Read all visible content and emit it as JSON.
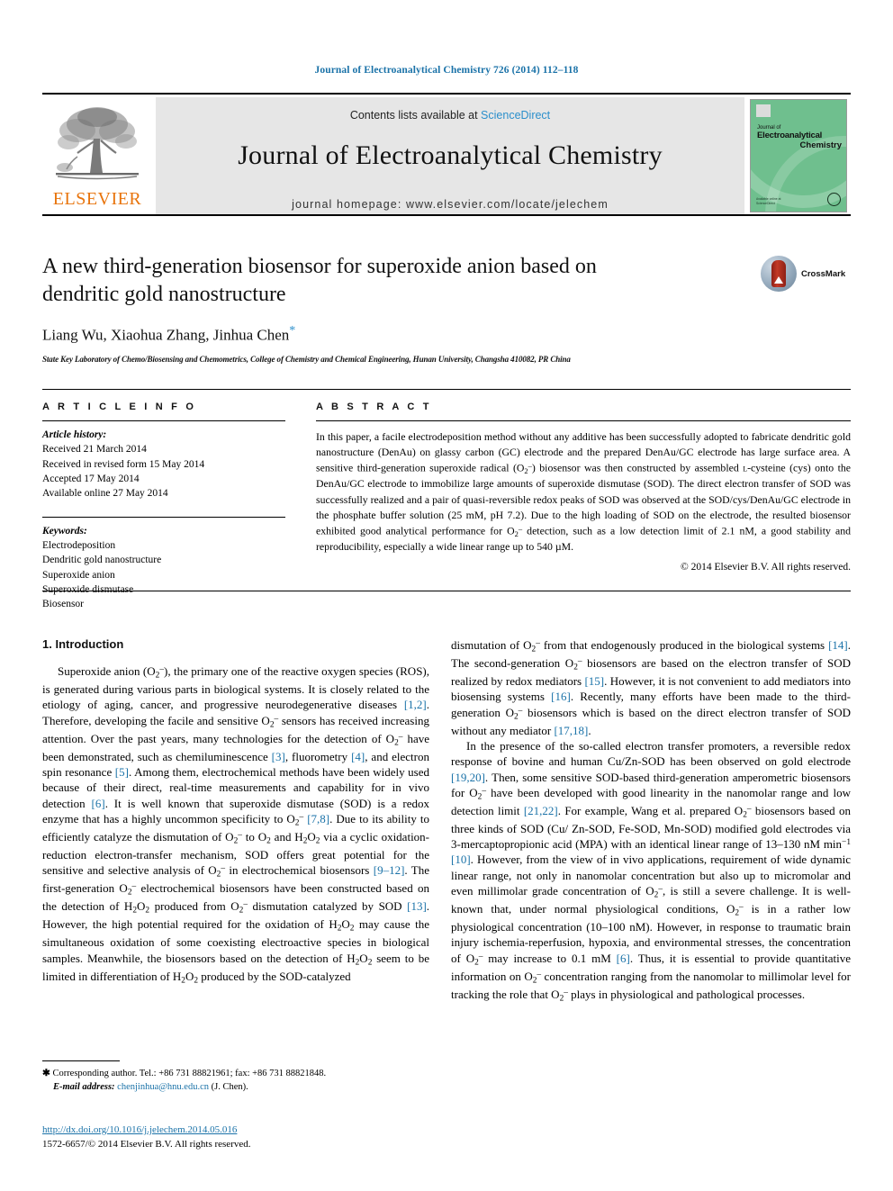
{
  "running_head": "Journal of Electroanalytical Chemistry 726 (2014) 112–118",
  "masthead": {
    "contents_prefix": "Contents lists available at ",
    "sciencedirect": "ScienceDirect",
    "journal_title": "Journal of Electroanalytical Chemistry",
    "homepage": "journal homepage: www.elsevier.com/locate/jelechem",
    "publisher_wordmark": "ELSEVIER",
    "cover": {
      "line1": "Journal of",
      "line2": "Electroanalytical",
      "line3": "Chemistry",
      "footer_left": "Available online at\nScienceDirect",
      "footer_right": "Official journal of the\nInternational Society of\nElectrochemistry"
    },
    "colors": {
      "link": "#2b8fcb",
      "elsevier_orange": "#e8740c",
      "cover_green": "#6fbf8e",
      "band_gray": "#e6e6e6"
    }
  },
  "article": {
    "title": "A new third-generation biosensor for superoxide anion based on dendritic gold nanostructure",
    "authors": "Liang Wu, Xiaohua Zhang, Jinhua Chen",
    "corresponding_marker": "*",
    "affiliation": "State Key Laboratory of Chemo/Biosensing and Chemometrics, College of Chemistry and Chemical Engineering, Hunan University, Changsha 410082, PR China",
    "crossmark_label": "CrossMark"
  },
  "article_info": {
    "heading": "A R T I C L E   I N F O",
    "history_label": "Article history:",
    "history": [
      "Received 21 March 2014",
      "Received in revised form 15 May 2014",
      "Accepted 17 May 2014",
      "Available online 27 May 2014"
    ],
    "keywords_label": "Keywords:",
    "keywords": [
      "Electrodeposition",
      "Dendritic gold nanostructure",
      "Superoxide anion",
      "Superoxide dismutase",
      "Biosensor"
    ]
  },
  "abstract": {
    "heading": "A B S T R A C T",
    "copyright": "© 2014 Elsevier B.V. All rights reserved."
  },
  "sections": {
    "intro_heading": "1. Introduction"
  },
  "footnote": {
    "corresponding": "Corresponding author. Tel.: +86 731 88821961; fax: +86 731 88821848.",
    "email_label": "E-mail address:",
    "email": "chenjinhua@hnu.edu.cn",
    "email_owner": "(J. Chen)."
  },
  "doi": {
    "url": "http://dx.doi.org/10.1016/j.jelechem.2014.05.016",
    "issn_line": "1572-6657/© 2014 Elsevier B.V. All rights reserved."
  }
}
